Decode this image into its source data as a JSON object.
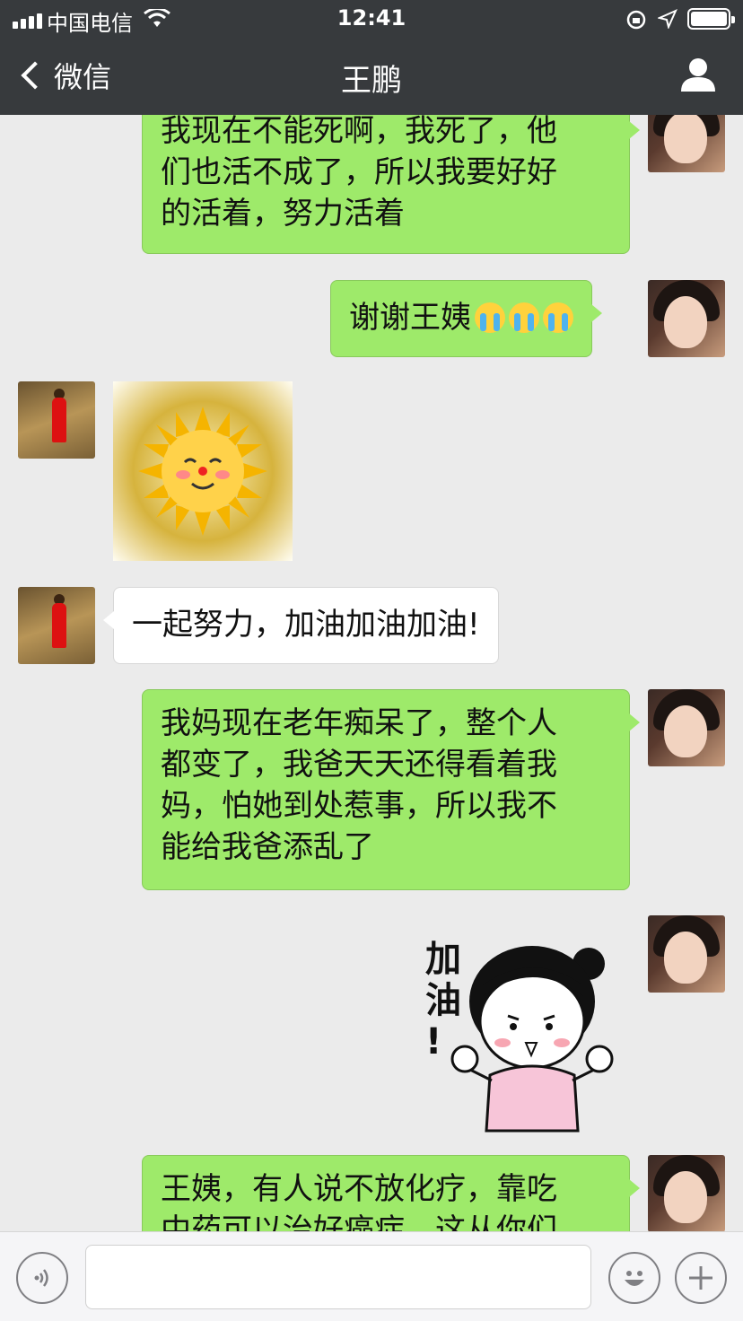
{
  "status_bar": {
    "carrier": "中国电信",
    "time": "12:41"
  },
  "nav": {
    "back_label": "微信",
    "title": "王鹏"
  },
  "messages": [
    {
      "sender": "me",
      "type": "text",
      "text": "我现在不能死啊，我死了，他\n们也活不成了，所以我要好好\n的活着，努力活着"
    },
    {
      "sender": "me",
      "type": "text",
      "text": "谢谢王姨",
      "emoji_count": 3,
      "emoji": "crying-face"
    },
    {
      "sender": "other",
      "type": "sticker",
      "sticker": "smiling-sun"
    },
    {
      "sender": "other",
      "type": "text",
      "text": "一起努力，加油加油加油!"
    },
    {
      "sender": "me",
      "type": "text",
      "text": "我妈现在老年痴呆了，整个人\n都变了，我爸天天还得看着我\n妈，怕她到处惹事，所以我不\n能给我爸添乱了"
    },
    {
      "sender": "me",
      "type": "sticker",
      "sticker": "girl-cheering",
      "caption": "加\n油\n!"
    },
    {
      "sender": "me",
      "type": "text",
      "text": "王姨，有人说不放化疗，靠吃\n中药可以治好癌症，这从你们"
    }
  ],
  "input": {
    "value": ""
  },
  "colors": {
    "nav_bg": "#373a3d",
    "chat_bg": "#ebebeb",
    "bubble_me": "#9eea6a",
    "bubble_other": "#ffffff"
  }
}
